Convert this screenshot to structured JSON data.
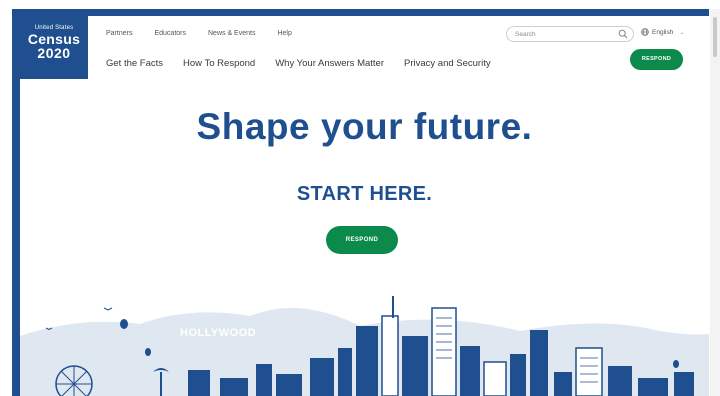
{
  "logo": {
    "line1": "United States",
    "line2": "Census",
    "line3": "2020"
  },
  "utility_nav": [
    "Partners",
    "Educators",
    "News & Events",
    "Help"
  ],
  "main_nav": [
    "Get the Facts",
    "How To Respond",
    "Why Your Answers Matter",
    "Privacy and Security"
  ],
  "search": {
    "placeholder": "Search"
  },
  "language": {
    "label": "English"
  },
  "header": {
    "respond_label": "RESPOND"
  },
  "hero": {
    "title": "Shape your future.",
    "subtitle": "START HERE.",
    "respond_label": "RESPOND"
  },
  "skyline": {
    "sign_text": "HOLLYWOOD"
  },
  "colors": {
    "brand_blue": "#1f4f8f",
    "accent_green": "#0c8a4c",
    "sky_light": "#dfe7f1"
  }
}
